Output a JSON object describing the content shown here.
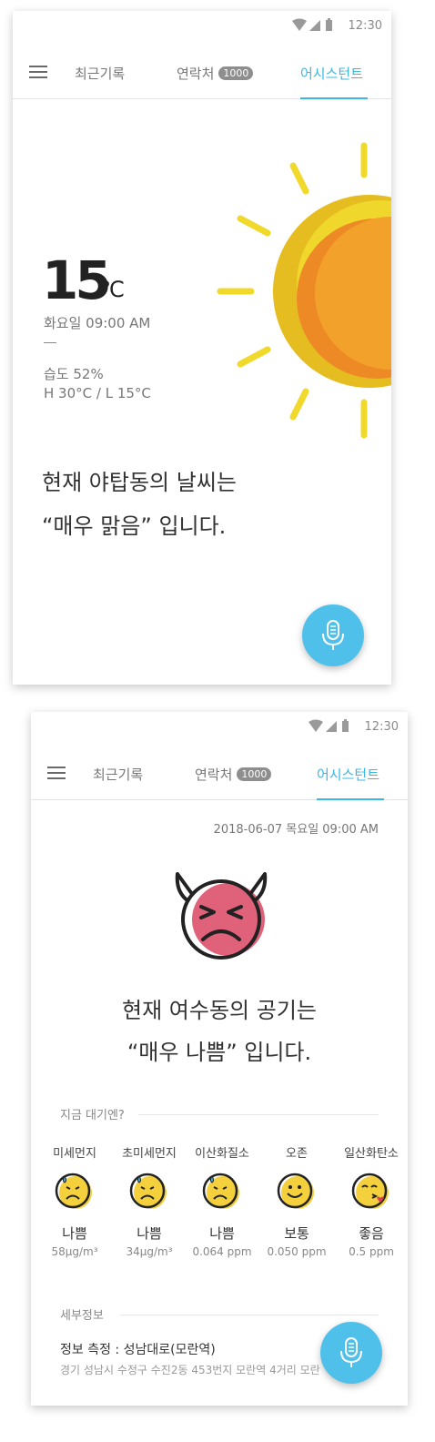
{
  "colors": {
    "accent": "#3ab8e5",
    "mic": "#4fc0ea",
    "sun_outer": "#e8c31c",
    "sun_inner": "#f0a024",
    "devil_face": "#e0627a",
    "face_yellow": "#f4d13c"
  },
  "screens": [
    {
      "status_time": "12:30",
      "nav": {
        "tab_recent": "최근기록",
        "tab_contacts": "연락처",
        "contacts_badge": "1000",
        "tab_assistant": "어시스턴트",
        "active": "assistant"
      },
      "weather": {
        "temp": "15",
        "unit": "℃",
        "datetime": "화요일  09:00 AM",
        "humidity": "습도 52%",
        "high_low": "H 30°C / L 15°C",
        "headline_line1": "현재 야탑동의 날씨는",
        "headline_line2": "“매우 맑음” 입니다.",
        "icon": "sun-icon"
      },
      "mic_icon": "microphone-icon"
    },
    {
      "status_time": "12:30",
      "nav": {
        "tab_recent": "최근기록",
        "tab_contacts": "연락처",
        "contacts_badge": "1000",
        "tab_assistant": "어시스턴트",
        "active": "assistant"
      },
      "air": {
        "datetime": "2018-06-07 목요일  09:00 AM",
        "icon": "angry-devil-face-icon",
        "headline_line1": "현재 여수동의 공기는",
        "headline_line2": "“매우 나쁨” 입니다.",
        "section_label": "지금 대기엔?",
        "items": [
          {
            "name": "미세먼지",
            "status": "나쁨",
            "value": "58μg/m³",
            "face": "sad-sweat-face-icon"
          },
          {
            "name": "초미세먼지",
            "status": "나쁨",
            "value": "34μg/m³",
            "face": "sad-sweat-face-icon"
          },
          {
            "name": "이산화질소",
            "status": "나쁨",
            "value": "0.064 ppm",
            "face": "sad-sweat-face-icon"
          },
          {
            "name": "오존",
            "status": "보통",
            "value": "0.050 ppm",
            "face": "smile-face-icon"
          },
          {
            "name": "일산화탄소",
            "status": "좋음",
            "value": "0.5 ppm",
            "face": "kiss-face-icon"
          }
        ],
        "detail_label": "세부정보",
        "station": "정보 측정 : 성남대로(모란역)",
        "address": "경기 성남시 수정구 수진2동 453번지 모란역 4거리 모란"
      },
      "mic_icon": "microphone-icon"
    }
  ]
}
